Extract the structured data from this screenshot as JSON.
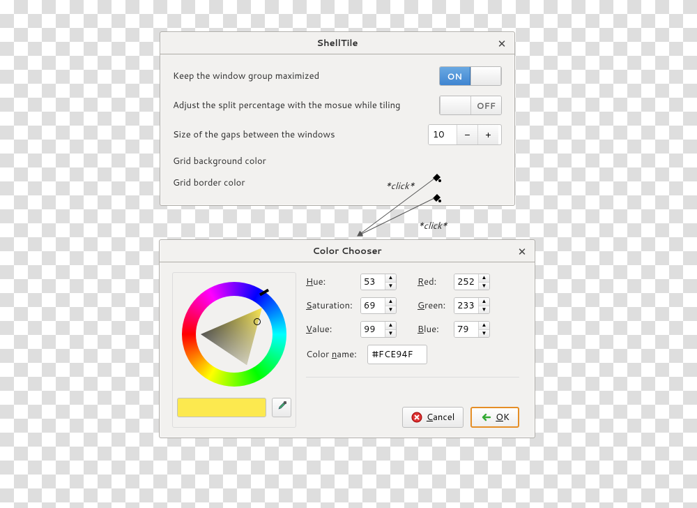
{
  "shelltile": {
    "title": "ShellTile",
    "row_maximize": "Keep the window group maximized",
    "row_split": "Adjust the split percentage with the mosue while tiling",
    "row_gap": "Size of the gaps between the windows",
    "row_bg": "Grid background color",
    "row_border": "Grid border color",
    "toggle_on": "ON",
    "toggle_off": "OFF",
    "gap_value": "10"
  },
  "click_label": "*click*",
  "color_chooser": {
    "title": "Color Chooser",
    "labels": {
      "hue": "Hue:",
      "saturation": "Saturation:",
      "value": "Value:",
      "red": "Red:",
      "green": "Green:",
      "blue": "Blue:",
      "name": "Color name:"
    },
    "hue": "53",
    "saturation": "69",
    "value": "99",
    "red": "252",
    "green": "233",
    "blue": "79",
    "color_hex": "#FCE94F",
    "cancel": "Cancel",
    "ok": "OK"
  }
}
